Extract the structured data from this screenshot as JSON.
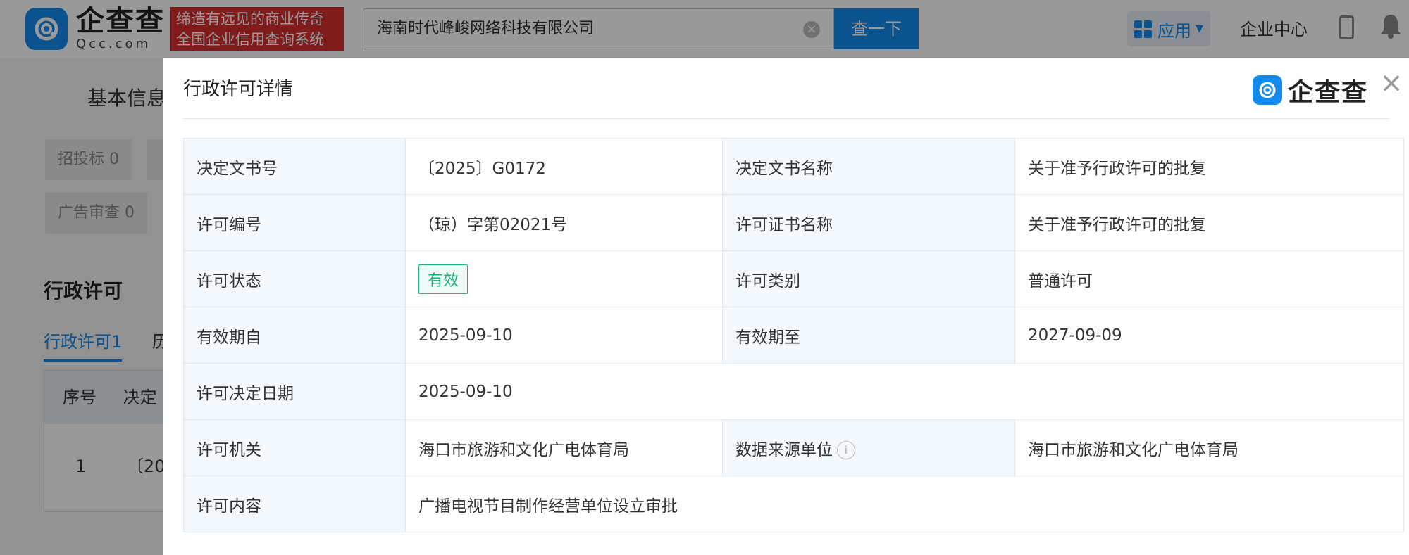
{
  "header": {
    "logo_cn": "企查查",
    "logo_en": "Qcc.com",
    "slogan_line1": "缔造有远见的商业传奇",
    "slogan_line2": "全国企业信用查询系统",
    "search_value": "海南时代峰峻网络科技有限公司",
    "search_button": "查一下",
    "apps_label": "应用",
    "enterprise_center": "企业中心"
  },
  "page": {
    "basic_info_tab": "基本信息",
    "chips": [
      "招投标 0",
      "广告审查 0"
    ],
    "section_title": "行政许可",
    "sub_tab_label": "行政许可",
    "sub_tab_count": "1",
    "sub_tab_next": "历",
    "table_head": [
      "序号",
      "决定"
    ],
    "table_row": [
      "1",
      "〔20"
    ]
  },
  "modal": {
    "title": "行政许可详情",
    "logo_text": "企查查",
    "rows": [
      {
        "l1": "决定文书号",
        "v1": "〔2025〕G0172",
        "l2": "决定文书名称",
        "v2": "关于准予行政许可的批复"
      },
      {
        "l1": "许可编号",
        "v1": "（琼）字第02021号",
        "l2": "许可证书名称",
        "v2": "关于准予行政许可的批复"
      },
      {
        "l1": "许可状态",
        "v1": "有效",
        "l2": "许可类别",
        "v2": "普通许可"
      },
      {
        "l1": "有效期自",
        "v1": "2025-09-10",
        "l2": "有效期至",
        "v2": "2027-09-09"
      },
      {
        "l1": "许可决定日期",
        "v1": "2025-09-10"
      },
      {
        "l1": "许可机关",
        "v1": "海口市旅游和文化广电体育局",
        "l2": "数据来源单位",
        "v2": "海口市旅游和文化广电体育局"
      },
      {
        "l1": "许可内容",
        "v1": "广播电视节目制作经营单位设立审批"
      }
    ]
  },
  "colors": {
    "brand_blue": "#128bed",
    "slogan_red": "#d62e2e",
    "status_green": "#1cb27a"
  }
}
